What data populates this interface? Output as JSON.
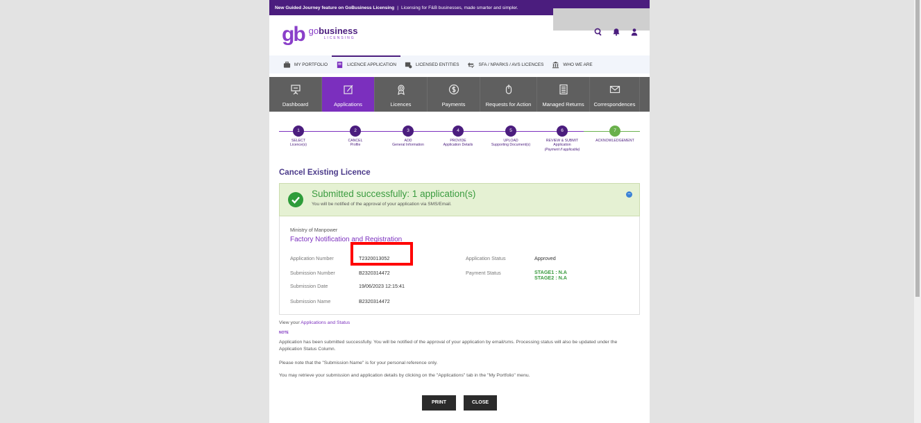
{
  "banner": {
    "bold_text": "New Guided Journey feature on GoBusiness Licensing",
    "separator": "|",
    "text": "Licensing for F&B businesses, made smarter and simpler."
  },
  "logo": {
    "mark": "gb",
    "brand_go": "go",
    "brand_business": "business",
    "sub": "LICENSING"
  },
  "top_nav": [
    {
      "label": "MY PORTFOLIO",
      "icon": "briefcase-icon"
    },
    {
      "label": "LICENCE APPLICATION",
      "icon": "document-icon"
    },
    {
      "label": "LICENSED ENTITIES",
      "icon": "entity-icon"
    },
    {
      "label": "SFA / NPARKS / AVS LICENCES",
      "icon": "exchange-icon"
    },
    {
      "label": "WHO WE ARE",
      "icon": "building-icon"
    }
  ],
  "tabs": [
    {
      "label": "Dashboard",
      "icon": "presentation-icon"
    },
    {
      "label": "Applications",
      "icon": "edit-icon"
    },
    {
      "label": "Licences",
      "icon": "award-icon"
    },
    {
      "label": "Payments",
      "icon": "dollar-icon"
    },
    {
      "label": "Requests for Action",
      "icon": "mouse-icon"
    },
    {
      "label": "Managed Returns",
      "icon": "list-icon"
    },
    {
      "label": "Correspondences",
      "icon": "envelope-icon"
    }
  ],
  "steps": [
    {
      "num": "1",
      "label": "SELECT",
      "sub": "Licence(s)",
      "sub2": ""
    },
    {
      "num": "2",
      "label": "CANCEL",
      "sub": "Profile",
      "sub2": ""
    },
    {
      "num": "3",
      "label": "ADD",
      "sub": "General Information",
      "sub2": ""
    },
    {
      "num": "4",
      "label": "PROVIDE",
      "sub": "Application Details",
      "sub2": ""
    },
    {
      "num": "5",
      "label": "UPLOAD",
      "sub": "Supporting Document(s)",
      "sub2": ""
    },
    {
      "num": "6",
      "label": "REVIEW & SUBMIT",
      "sub": "Application",
      "sub2": "(Payment if applicable)"
    },
    {
      "num": "7",
      "label": "ACKNOWLEDGEMENT",
      "sub": "",
      "sub2": ""
    }
  ],
  "section_title": "Cancel Existing Licence",
  "success": {
    "heading": "Submitted successfully: 1 application(s)",
    "message": "You will be notified of the approval of your application via SMS/Email.",
    "toggle": "−"
  },
  "details": {
    "ministry": "Ministry of Manpower",
    "licence_name": "Factory Notification and Registration",
    "application_number_label": "Application Number",
    "application_number": "T2320013052",
    "submission_number_label": "Submission Number",
    "submission_number": "B2320314472",
    "submission_date_label": "Submission Date",
    "submission_date": "19/06/2023 12:15:41",
    "submission_name_label": "Submission Name",
    "submission_name": "B2320314472",
    "application_status_label": "Application Status",
    "application_status": "Approved",
    "payment_status_label": "Payment Status",
    "payment_stage1": "STAGE1 : N.A",
    "payment_stage2": "STAGE2 : N.A"
  },
  "footer": {
    "view_prefix": "View your",
    "view_link": "Applications and Status",
    "note_label": "NOTE",
    "note1": "Application has been submitted successfully. You will be notified of the approval of your application by email/sms. Processing status will also be updated under the Application Status Column.",
    "note2": "Please note that the \"Submission Name\" is for your personal reference only.",
    "note3": "You may retrieve your submission and application details by clicking on the \"Applications\" tab in the \"My Portfolio\" menu."
  },
  "buttons": {
    "print": "PRINT",
    "close": "CLOSE"
  },
  "colors": {
    "brand_purple": "#4b1d7e",
    "active_tab": "#7b2fbe",
    "success_green": "#3a9b3f",
    "highlight_red": "#ff0000"
  }
}
